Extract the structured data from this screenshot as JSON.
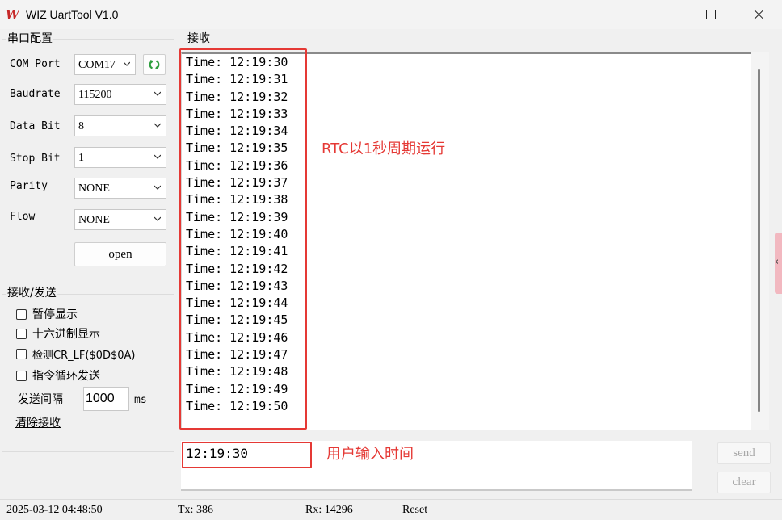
{
  "window": {
    "title": "WIZ UartTool V1.0",
    "icon_glyph": "W",
    "icon_name": "wiz-logo-icon"
  },
  "port_config": {
    "title": "串口配置",
    "fields": [
      {
        "label": "COM Port",
        "value": "COM17"
      },
      {
        "label": "Baudrate",
        "value": "115200"
      },
      {
        "label": "Data Bit",
        "value": "8"
      },
      {
        "label": "Stop Bit",
        "value": "1"
      },
      {
        "label": "Parity",
        "value": "NONE"
      },
      {
        "label": "Flow",
        "value": "NONE"
      }
    ],
    "open_label": "open"
  },
  "recv_send": {
    "title": "接收/发送",
    "checkboxes": [
      {
        "label": "暂停显示",
        "checked": false
      },
      {
        "label": "十六进制显示",
        "checked": false
      },
      {
        "label": "检测CR_LF($0D$0A)",
        "checked": false
      },
      {
        "label": "指令循环发送",
        "checked": false
      }
    ],
    "interval_label": "发送间隔",
    "interval_value": "1000",
    "interval_unit": "ms",
    "clear_recv_label": "清除接收"
  },
  "receive": {
    "title": "接收",
    "lines": [
      "Time: 12:19:30",
      "Time: 12:19:31",
      "Time: 12:19:32",
      "Time: 12:19:33",
      "Time: 12:19:34",
      "Time: 12:19:35",
      "Time: 12:19:36",
      "Time: 12:19:37",
      "Time: 12:19:38",
      "Time: 12:19:39",
      "Time: 12:19:40",
      "Time: 12:19:41",
      "Time: 12:19:42",
      "Time: 12:19:43",
      "Time: 12:19:44",
      "Time: 12:19:45",
      "Time: 12:19:46",
      "Time: 12:19:47",
      "Time: 12:19:48",
      "Time: 12:19:49",
      "Time: 12:19:50"
    ],
    "annotation": "RTC以1秒周期运行"
  },
  "send": {
    "text": "12:19:30",
    "annotation": "用户输入时间",
    "send_label": "send",
    "clear_label": "clear"
  },
  "status": {
    "datetime": "2025-03-12 04:48:50",
    "tx": "Tx: 386",
    "rx": "Rx: 14296",
    "reset": "Reset"
  },
  "colors": {
    "annotation_red": "#e53935",
    "refresh_green": "#2e9e3e",
    "logo_red": "#c62828"
  }
}
